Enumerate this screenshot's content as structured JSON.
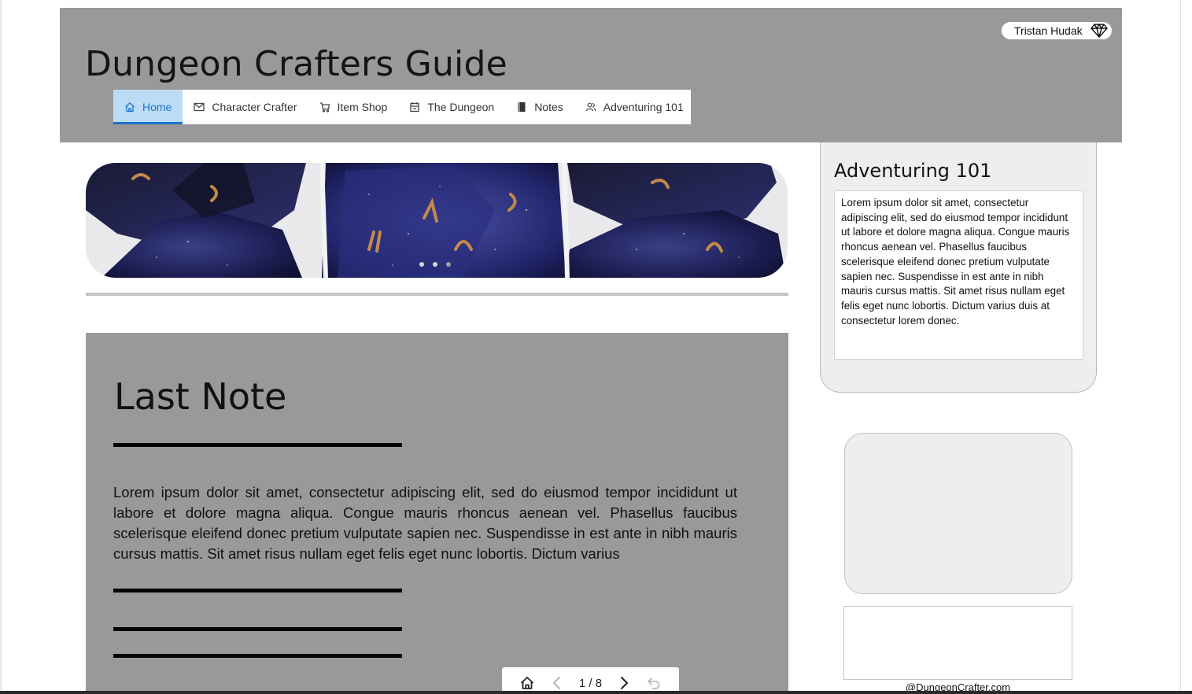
{
  "header": {
    "site_title": "Dungeon Crafters Guide",
    "user_name": "Tristan Hudak",
    "user_badge_icon": "diamond-icon"
  },
  "nav": {
    "items": [
      {
        "label": "Home",
        "icon": "home-icon",
        "active": true
      },
      {
        "label": "Character Crafter",
        "icon": "mail-icon",
        "active": false
      },
      {
        "label": "Item Shop",
        "icon": "cart-icon",
        "active": false
      },
      {
        "label": "The Dungeon",
        "icon": "calendar-icon",
        "active": false
      },
      {
        "label": "Notes",
        "icon": "notebook-icon",
        "active": false
      },
      {
        "label": "Adventuring 101",
        "icon": "users-icon",
        "active": false
      }
    ],
    "accent_color": "#1a73c9",
    "active_background": "#bcdcf5"
  },
  "carousel": {
    "slide_count": 3,
    "active_slide": 3
  },
  "last_note": {
    "title": "Last Note",
    "text": "Lorem ipsum dolor sit amet, consectetur adipiscing elit, sed do eiusmod tempor incididunt ut labore et dolore magna aliqua. Congue mauris rhoncus aenean vel. Phasellus faucibus scelerisque eleifend donec pretium vulputate sapien nec. Suspendisse in est ante in nibh mauris cursus mattis. Sit amet risus nullam eget felis eget nunc lobortis. Dictum varius"
  },
  "pager": {
    "current_page": 1,
    "total_pages": 8,
    "label": "1 / 8"
  },
  "sidebar": {
    "title": "Adventuring 101",
    "text": "Lorem ipsum dolor sit amet, consectetur adipiscing elit, sed do eiusmod tempor incididunt ut labore et dolore magna aliqua. Congue mauris rhoncus aenean vel. Phasellus faucibus scelerisque eleifend donec pretium vulputate sapien nec. Suspendisse in est ante in nibh mauris cursus mattis. Sit amet risus nullam eget felis eget nunc lobortis. Dictum varius duis at consectetur lorem donec."
  },
  "footer": {
    "handle": "@DungeonCrafter.com"
  },
  "colors": {
    "header_bg": "#999999",
    "panel_bg": "#999999",
    "card_bg": "#eeeeee"
  }
}
